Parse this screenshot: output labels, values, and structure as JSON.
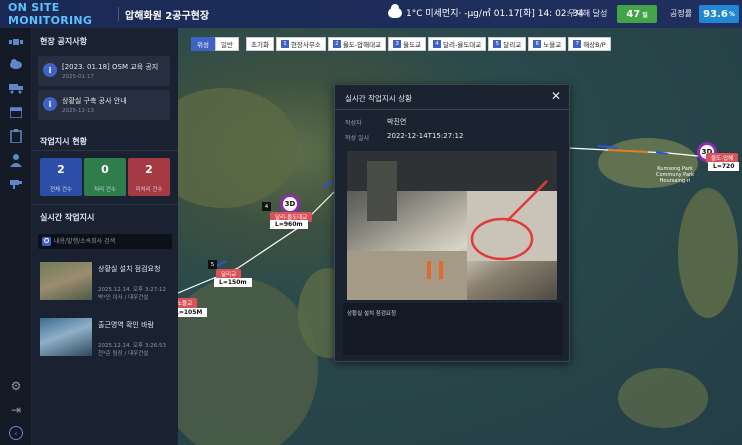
{
  "header": {
    "brand": "ON SITE MONITORING",
    "site": "압해화원 2공구현장",
    "weather": "1°C  미세먼지· -μg/㎥  01.17[화] 14: 02: 34",
    "accident_free_label": "무재해 달성",
    "accident_free_value": "47",
    "accident_free_unit": "일",
    "progress_label": "공정률",
    "progress_value": "93.6",
    "progress_unit": "%"
  },
  "sidebar": {
    "notice_title": "현장 공지사항",
    "notices": [
      {
        "title": "[2023. 01.18] OSM 교육 공지",
        "date": "2025-01-17"
      },
      {
        "title": "상황실 구축 공사 안내",
        "date": "2025-12-13"
      }
    ],
    "work_status_title": "작업지시 현황",
    "stats": [
      {
        "value": "2",
        "label": "전체 건수",
        "color": "#2c4ea8"
      },
      {
        "value": "0",
        "label": "처리 건수",
        "color": "#2e7d4a"
      },
      {
        "value": "2",
        "label": "미처리 건수",
        "color": "#a53a44"
      }
    ],
    "realtime_title": "실시간 작업지시",
    "search_placeholder": "내용/발행/소속회사 검색",
    "items": [
      {
        "title": "상황실 설치 점검요청",
        "meta1": "2025.12.14. 오후 3:27:12",
        "meta2": "박*인 이사 / 대우건설"
      },
      {
        "title": "출근명역 확인 바람",
        "meta1": "2025.12.14. 오후 3:26:53",
        "meta2": "천*준 팀장 / 대우건설"
      }
    ]
  },
  "map": {
    "tabs": [
      "위성",
      "일반"
    ],
    "reset_label": "초기화",
    "zones": [
      {
        "num": "1",
        "label": "현장사무소"
      },
      {
        "num": "2",
        "label": "율도-압해대교"
      },
      {
        "num": "3",
        "label": "율도교"
      },
      {
        "num": "4",
        "label": "달리-율도대교"
      },
      {
        "num": "5",
        "label": "달리교"
      },
      {
        "num": "6",
        "label": "노을교"
      },
      {
        "num": "7",
        "label": "해상B/P"
      }
    ],
    "bridges": [
      {
        "tag": "4",
        "name": "달리-율도대교",
        "length": "L=960m"
      },
      {
        "tag": "5",
        "name": "달리교",
        "length": "L=150m"
      },
      {
        "tag": "",
        "name": "노을교",
        "length": "L=105M"
      },
      {
        "tag": "",
        "name": "율도-압해",
        "length": "L=720"
      }
    ],
    "pin_label": "3D",
    "place_name": "Kumsong Park\nCommuny Park\nHoursaing-ri"
  },
  "modal": {
    "title": "실시간 작업지시 상황",
    "author_label": "작성자",
    "author_value": "박진연",
    "date_label": "작성 일시",
    "date_value": "2022-12-14T15:27:12",
    "description": "상황실 설치 점검요청"
  }
}
